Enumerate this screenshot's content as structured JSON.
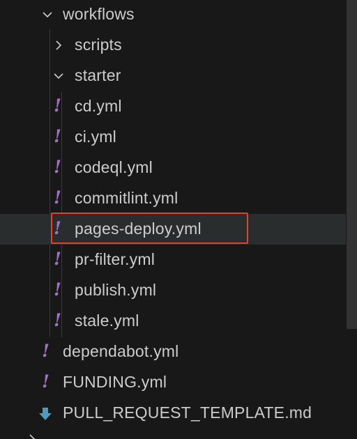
{
  "explorer": {
    "items": [
      {
        "label": "workflows",
        "kind": "folder",
        "expanded": true,
        "icon": "chevron-down-icon"
      },
      {
        "label": "scripts",
        "kind": "folder",
        "expanded": false,
        "icon": "chevron-right-icon"
      },
      {
        "label": "starter",
        "kind": "folder",
        "expanded": true,
        "icon": "chevron-down-icon"
      },
      {
        "label": "cd.yml",
        "kind": "file",
        "icon": "yaml-file-icon",
        "icon_glyph": "!"
      },
      {
        "label": "ci.yml",
        "kind": "file",
        "icon": "yaml-file-icon",
        "icon_glyph": "!"
      },
      {
        "label": "codeql.yml",
        "kind": "file",
        "icon": "yaml-file-icon",
        "icon_glyph": "!"
      },
      {
        "label": "commitlint.yml",
        "kind": "file",
        "icon": "yaml-file-icon",
        "icon_glyph": "!"
      },
      {
        "label": "pages-deploy.yml",
        "kind": "file",
        "icon": "yaml-file-icon",
        "icon_glyph": "!",
        "selected": true,
        "highlighted": true
      },
      {
        "label": "pr-filter.yml",
        "kind": "file",
        "icon": "yaml-file-icon",
        "icon_glyph": "!"
      },
      {
        "label": "publish.yml",
        "kind": "file",
        "icon": "yaml-file-icon",
        "icon_glyph": "!"
      },
      {
        "label": "stale.yml",
        "kind": "file",
        "icon": "yaml-file-icon",
        "icon_glyph": "!"
      },
      {
        "label": "dependabot.yml",
        "kind": "file",
        "icon": "yaml-file-icon",
        "icon_glyph": "!"
      },
      {
        "label": "FUNDING.yml",
        "kind": "file",
        "icon": "yaml-file-icon",
        "icon_glyph": "!"
      },
      {
        "label": "PULL_REQUEST_TEMPLATE.md",
        "kind": "file",
        "icon": "markdown-arrow-icon"
      }
    ]
  },
  "colors": {
    "background": "#181818",
    "text": "#cccccc",
    "selected_row": "#2a2d2e",
    "yaml_icon": "#a074c4",
    "markdown_icon": "#519aba",
    "highlight_border": "#e0442a",
    "indent_guide": "#3b3b3b",
    "scrollbar": "#333333"
  }
}
